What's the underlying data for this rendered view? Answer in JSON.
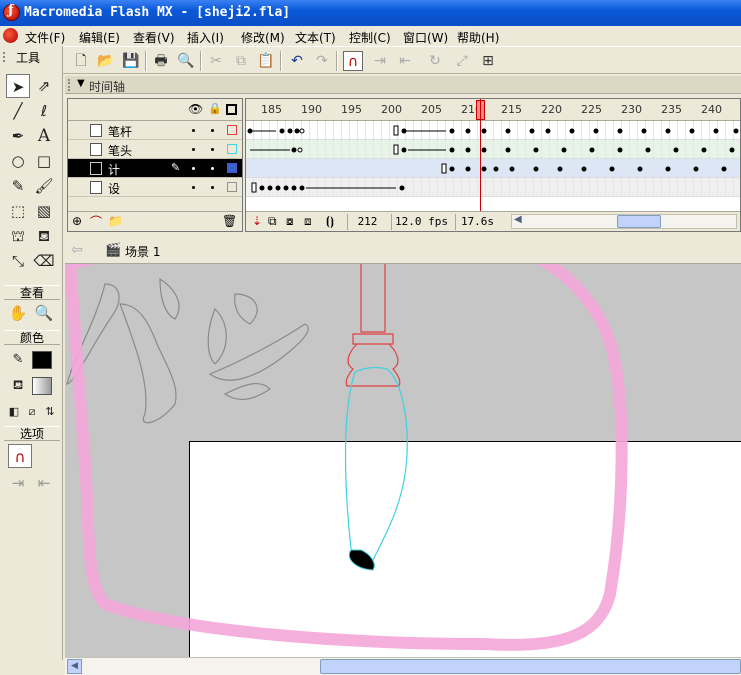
{
  "window": {
    "title": "Macromedia Flash MX - [sheji2.fla]"
  },
  "menu": {
    "items": [
      "文件(F)",
      "编辑(E)",
      "查看(V)",
      "插入(I)",
      "修改(M)",
      "文本(T)",
      "控制(C)",
      "窗口(W)",
      "帮助(H)"
    ]
  },
  "tools_panel": {
    "title": "工具",
    "view_label": "查看",
    "colors_label": "颜色",
    "options_label": "选项"
  },
  "timeline": {
    "title": "时间轴",
    "ruler_labels": [
      "185",
      "190",
      "195",
      "200",
      "205",
      "210",
      "215",
      "220",
      "225",
      "230",
      "235",
      "240"
    ],
    "layers": [
      {
        "name": "笔杆",
        "outline_color": "#e04040",
        "active": false
      },
      {
        "name": "笔头",
        "outline_color": "#40d8e0",
        "active": false
      },
      {
        "name": "计",
        "outline_color": "#4060d0",
        "active": true
      },
      {
        "name": "设",
        "outline_color": "#909090",
        "active": false
      }
    ],
    "current_frame": "212",
    "frame_rate": "12.0 fps",
    "elapsed_time": "17.6s"
  },
  "scene": {
    "label": "场景 1"
  },
  "colors": {
    "brush_handle": "#e04040",
    "brush_tip": "#40d0e0",
    "annotation_circle": "#f4a6d8",
    "title_bar": "#0a58d8"
  }
}
